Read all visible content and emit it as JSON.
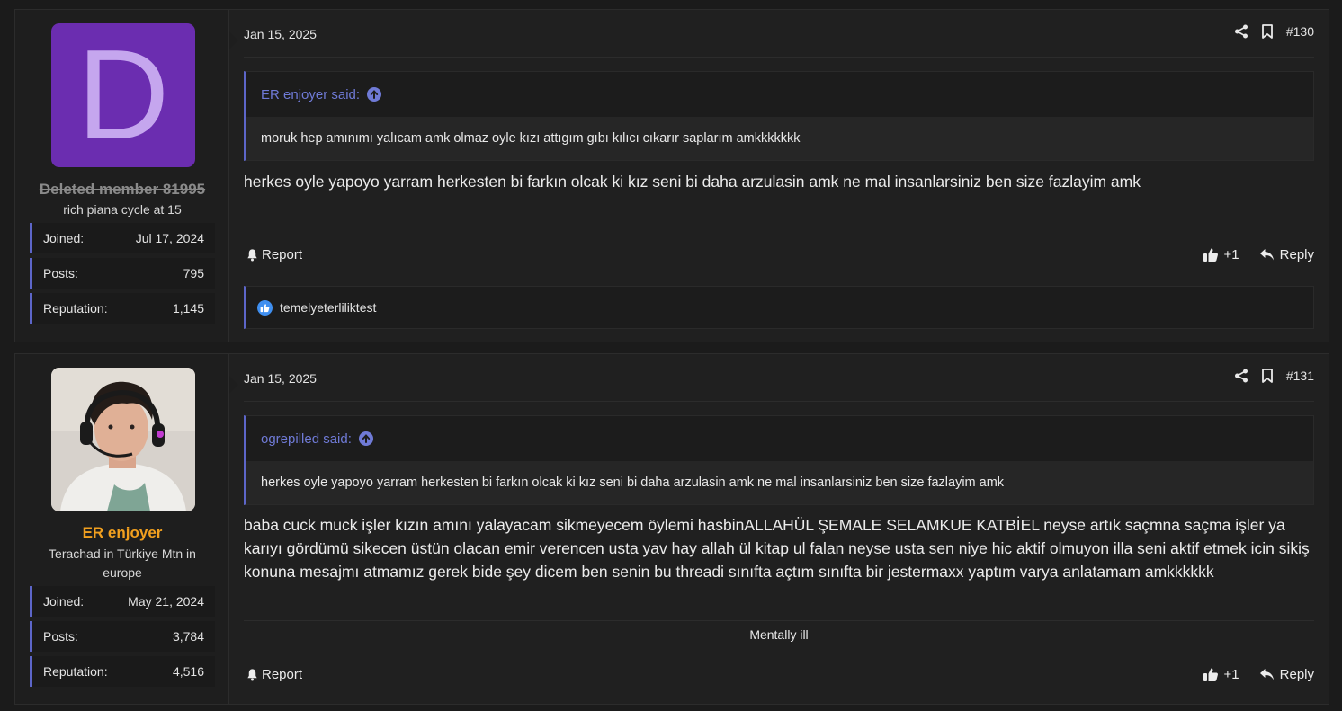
{
  "posts": [
    {
      "avatar_letter": "D",
      "username": "Deleted member 81995",
      "user_title": "rich piana cycle at 15",
      "stats": [
        {
          "label": "Joined:",
          "value": "Jul 17, 2024"
        },
        {
          "label": "Posts:",
          "value": "795"
        },
        {
          "label": "Reputation:",
          "value": "1,145"
        }
      ],
      "date": "Jan 15, 2025",
      "post_number": "#130",
      "quote_author": "ER enjoyer said:",
      "quote_text": "moruk hep amınımı yalıcam amk olmaz oyle kızı attıgım gıbı kılıcı cıkarır saplarım amkkkkkkk",
      "message": "herkes oyle yapoyo yarram herkesten bi farkın olcak ki kız seni bi daha arzulasin amk ne mal insanlarsiniz ben size fazlayim amk",
      "report_label": "Report",
      "like_count": "+1",
      "reply_label": "Reply",
      "reaction_user": "temelyeterliliktest"
    },
    {
      "username": "ER enjoyer",
      "user_title": "Terachad in Türkiye Mtn in europe",
      "stats": [
        {
          "label": "Joined:",
          "value": "May 21, 2024"
        },
        {
          "label": "Posts:",
          "value": "3,784"
        },
        {
          "label": "Reputation:",
          "value": "4,516"
        }
      ],
      "date": "Jan 15, 2025",
      "post_number": "#131",
      "quote_author": "ogrepilled said:",
      "quote_text": "herkes oyle yapoyo yarram herkesten bi farkın olcak ki kız seni bi daha arzulasin amk ne mal insanlarsiniz ben size fazlayim amk",
      "message": "baba cuck muck işler kızın amını yalayacam sikmeyecem öylemi hasbinALLAHÜL ŞEMALE SELAMKUE KATBİEL neyse artık saçmna saçma işler ya karıyı gördümü sikecen üstün olacan emir verencen usta yav hay allah ül kitap ul falan neyse usta sen niye hic aktif olmuyon illa seni aktif etmek icin sikiş konuna mesajmı atmamız gerek bide şey dicem ben senin bu threadi sınıfta açtım sınıfta bir jestermaxx yaptım varya anlatamam amkkkkkk",
      "signature": "Mentally ill",
      "report_label": "Report",
      "like_count": "+1",
      "reply_label": "Reply"
    }
  ],
  "colors": {
    "accent": "#5d66c9",
    "username_active": "#f2a01f",
    "avatar_bg": "#6b2db0",
    "like": "#3f8ff0"
  },
  "icons": [
    "share-icon",
    "bookmark-icon",
    "arrow-up-circle-icon",
    "bell-icon",
    "thumbs-up-icon",
    "reply-icon",
    "like-reaction-icon"
  ]
}
